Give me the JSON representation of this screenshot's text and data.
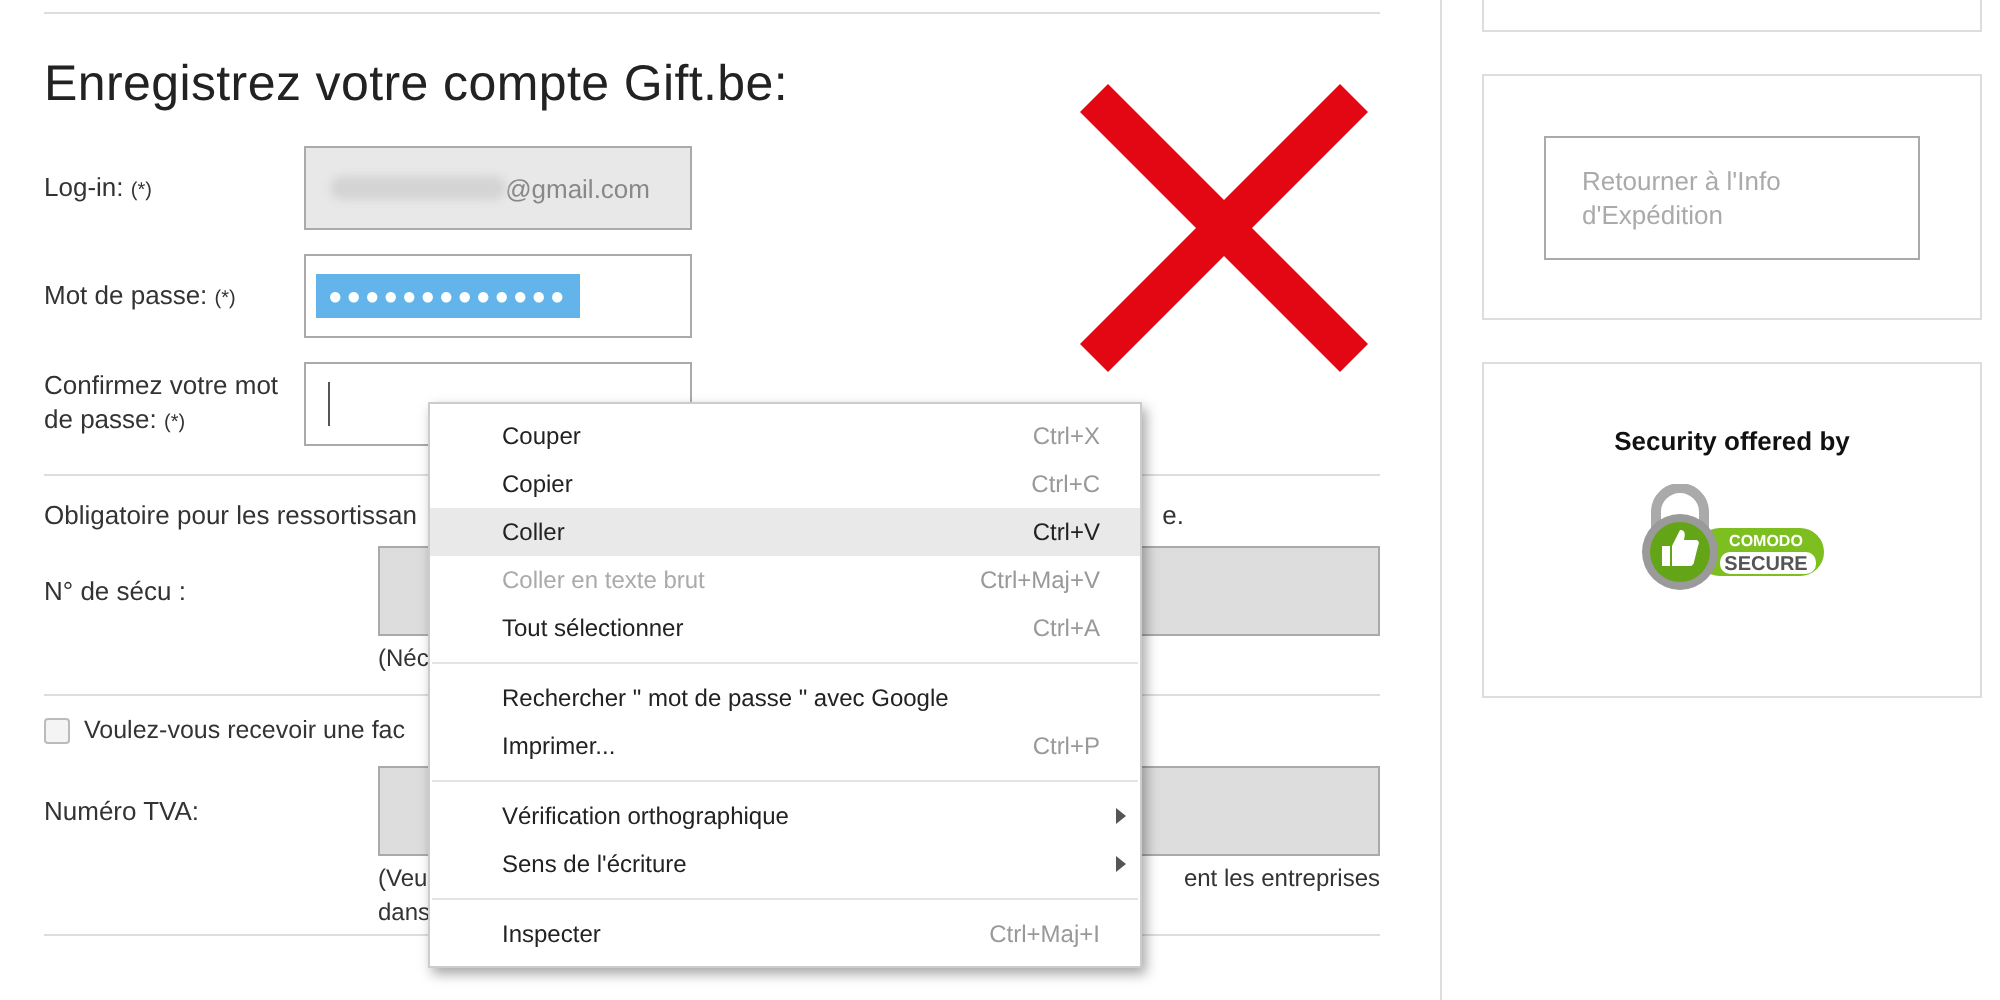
{
  "form": {
    "title": "Enregistrez votre compte Gift.be:",
    "fields": [
      {
        "kind": "login",
        "label": "Log-in:",
        "required": "(*)",
        "value": "@gmail.com"
      },
      {
        "kind": "password",
        "label": "Mot de passe:",
        "required": "(*)",
        "value": "●●●●●●●●●●●●●",
        "selected": true
      },
      {
        "kind": "confirm",
        "label": "Confirmez votre mot de passe:",
        "required": "(*)",
        "focused": true
      }
    ],
    "notice_left": "Obligatoire pour les ressortissan",
    "notice_right": "e.",
    "secu": {
      "label": "N° de sécu :",
      "hint": "(Néc"
    },
    "invoice": {
      "label": "Voulez-vous recevoir une fac",
      "checked": false
    },
    "vat": {
      "label": "Numéro TVA:",
      "hint_left": "(Veu",
      "hint_right": "ent les entreprises",
      "hint_line2": "dans"
    }
  },
  "sidebar": {
    "back_button": "Retourner à l'Info d'Expédition",
    "security_title": "Security offered by",
    "badge_top": "COMODO",
    "badge_bottom": "SECURE"
  },
  "context_menu": [
    {
      "kind": "item",
      "label": "Couper",
      "shortcut": "Ctrl+X",
      "highlighted": false,
      "disabled": false
    },
    {
      "kind": "item",
      "label": "Copier",
      "shortcut": "Ctrl+C",
      "highlighted": false,
      "disabled": false
    },
    {
      "kind": "item",
      "label": "Coller",
      "shortcut": "Ctrl+V",
      "highlighted": true,
      "disabled": false
    },
    {
      "kind": "item",
      "label": "Coller en texte brut",
      "shortcut": "Ctrl+Maj+V",
      "highlighted": false,
      "disabled": true
    },
    {
      "kind": "item",
      "label": "Tout sélectionner",
      "shortcut": "Ctrl+A",
      "highlighted": false,
      "disabled": false
    },
    {
      "kind": "separator"
    },
    {
      "kind": "item",
      "label": "Rechercher \" mot de passe \" avec Google",
      "highlighted": false,
      "disabled": false
    },
    {
      "kind": "item",
      "label": "Imprimer...",
      "shortcut": "Ctrl+P",
      "highlighted": false,
      "disabled": false
    },
    {
      "kind": "separator"
    },
    {
      "kind": "submenu",
      "label": "Vérification orthographique",
      "highlighted": false,
      "disabled": false
    },
    {
      "kind": "submenu",
      "label": "Sens de l'écriture",
      "highlighted": false,
      "disabled": false
    },
    {
      "kind": "separator"
    },
    {
      "kind": "item",
      "label": "Inspecter",
      "shortcut": "Ctrl+Maj+I",
      "highlighted": false,
      "disabled": false
    }
  ]
}
